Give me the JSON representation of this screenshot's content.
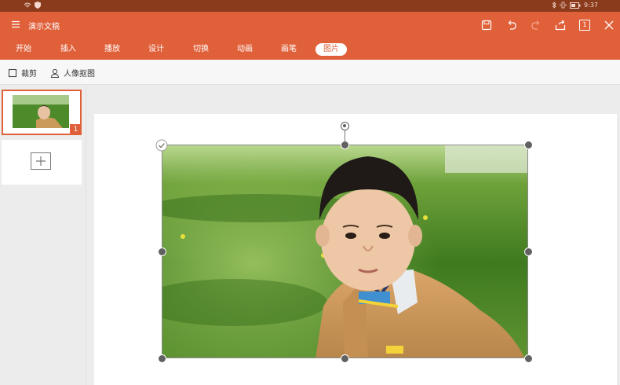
{
  "status_bar": {
    "time": "9:37",
    "icons": [
      "wifi-icon",
      "shield-icon",
      "bluetooth-icon",
      "vibrate-icon",
      "battery-icon"
    ]
  },
  "title_bar": {
    "title": "演示文稿",
    "icons": [
      "menu-icon",
      "save-icon",
      "undo-icon",
      "redo-icon",
      "share-icon",
      "slide-count-icon",
      "close-icon"
    ],
    "slide_count_label": "1"
  },
  "tabs": [
    {
      "label": "开始"
    },
    {
      "label": "插入"
    },
    {
      "label": "播放"
    },
    {
      "label": "设计"
    },
    {
      "label": "切换"
    },
    {
      "label": "动画"
    },
    {
      "label": "画笔"
    },
    {
      "label": "图片"
    }
  ],
  "active_tab": "图片",
  "picture_tools": {
    "crop_label": "裁剪",
    "portrait_cutout_label": "人像抠图"
  },
  "slides_panel": {
    "thumbnails": [
      {
        "number": "1"
      }
    ],
    "add_slide_icon": "plus-icon"
  },
  "colors": {
    "accent": "#e0603a",
    "status_bar": "#8a3b1c",
    "handle": "#616161"
  }
}
